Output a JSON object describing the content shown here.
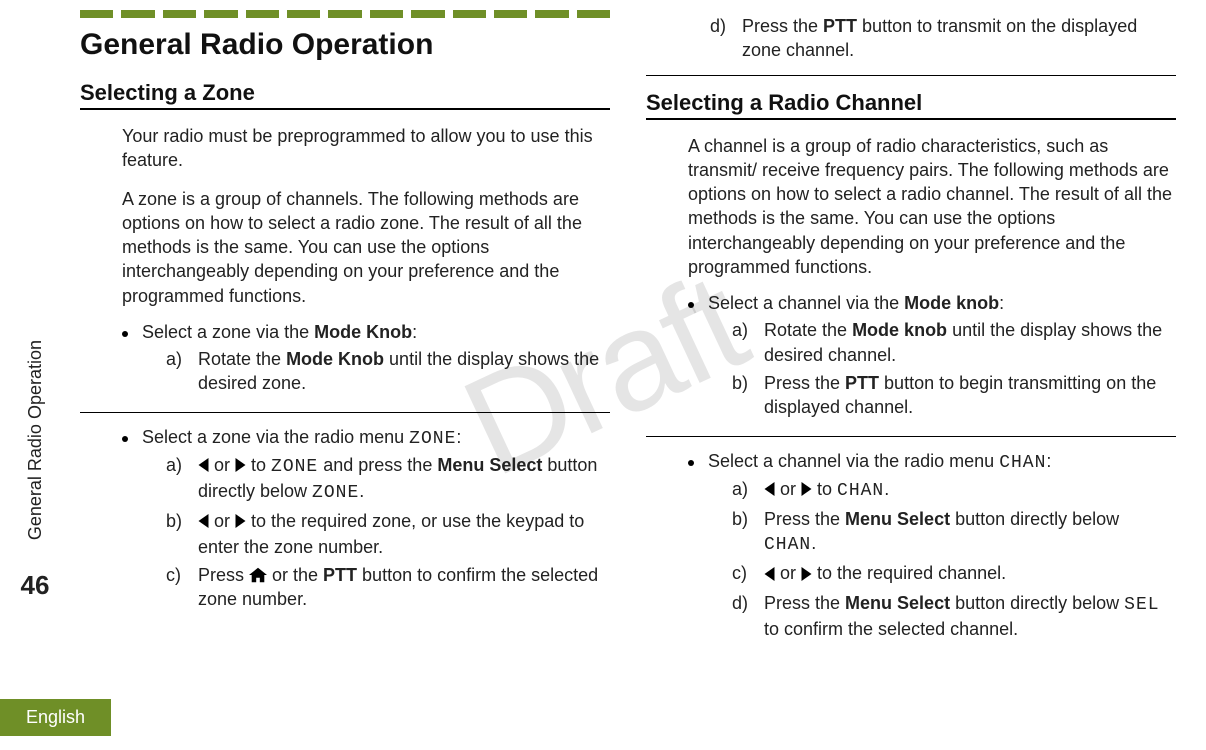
{
  "watermark": "Draft",
  "rail": {
    "section": "General Radio Operation",
    "page": "46",
    "lang": "English"
  },
  "left": {
    "h1": "General Radio Operation",
    "h2": "Selecting a Zone",
    "p1": "Your radio must be preprogrammed to allow you to use this feature.",
    "p2": "A zone is a group of channels. The following methods are options on how to select a radio zone. The result of all the methods is the same. You can use the options interchangeably depending on your preference and the programmed functions.",
    "b1_pre": "Select a zone via the ",
    "b1_bold": "Mode Knob",
    "b1_post": ":",
    "b1a_pre": "Rotate the ",
    "b1a_bold": "Mode Knob",
    "b1a_post": " until the display shows the desired zone.",
    "b2_pre": "Select a zone via the radio menu ",
    "b2_mono": "ZONE",
    "b2_post": ":",
    "b2a_mid": " to ",
    "b2a_mono": "ZONE",
    "b2a_mid2": " and press the ",
    "b2a_bold": "Menu Select",
    "b2a_post": " button directly below ",
    "b2a_mono2": "ZONE",
    "b2a_end": ".",
    "b2b": " to the required zone, or use the keypad to enter the zone number.",
    "b2c_pre": "Press ",
    "b2c_mid": " or the ",
    "b2c_bold": "PTT",
    "b2c_post": " button to confirm the selected zone number.",
    "or": " or "
  },
  "right": {
    "d_pre": "Press the ",
    "d_bold": "PTT",
    "d_post": " button to transmit on the displayed zone channel.",
    "h2": "Selecting a Radio Channel",
    "p1": "A channel is a group of radio characteristics, such as transmit/ receive frequency pairs. The following methods are options on how to select a radio channel. The result of all the methods is the same. You can use the options interchangeably depending on your preference and the programmed functions.",
    "b1_pre": "Select a channel via the ",
    "b1_bold": "Mode knob",
    "b1_post": ":",
    "b1a_pre": "Rotate the ",
    "b1a_bold": "Mode knob",
    "b1a_post": " until the display shows the desired channel.",
    "b1b_pre": "Press the ",
    "b1b_bold": "PTT",
    "b1b_post": " button to begin transmitting on the displayed channel.",
    "b2_pre": "Select a channel via the radio menu ",
    "b2_mono": "CHAN",
    "b2_post": ":",
    "b2a_mid": " to ",
    "b2a_mono": "CHAN",
    "b2a_end": ".",
    "b2b_pre": "Press the ",
    "b2b_bold": "Menu Select",
    "b2b_post": " button directly below ",
    "b2b_mono": "CHAN",
    "b2b_end": ".",
    "b2c": " to the required channel.",
    "b2d_pre": "Press the ",
    "b2d_bold": "Menu Select",
    "b2d_post": " button directly below ",
    "b2d_mono": "SEL",
    "b2d_end": " to confirm the selected channel.",
    "or": " or "
  },
  "labels": {
    "a": "a)",
    "b": "b)",
    "c": "c)",
    "d": "d)"
  }
}
